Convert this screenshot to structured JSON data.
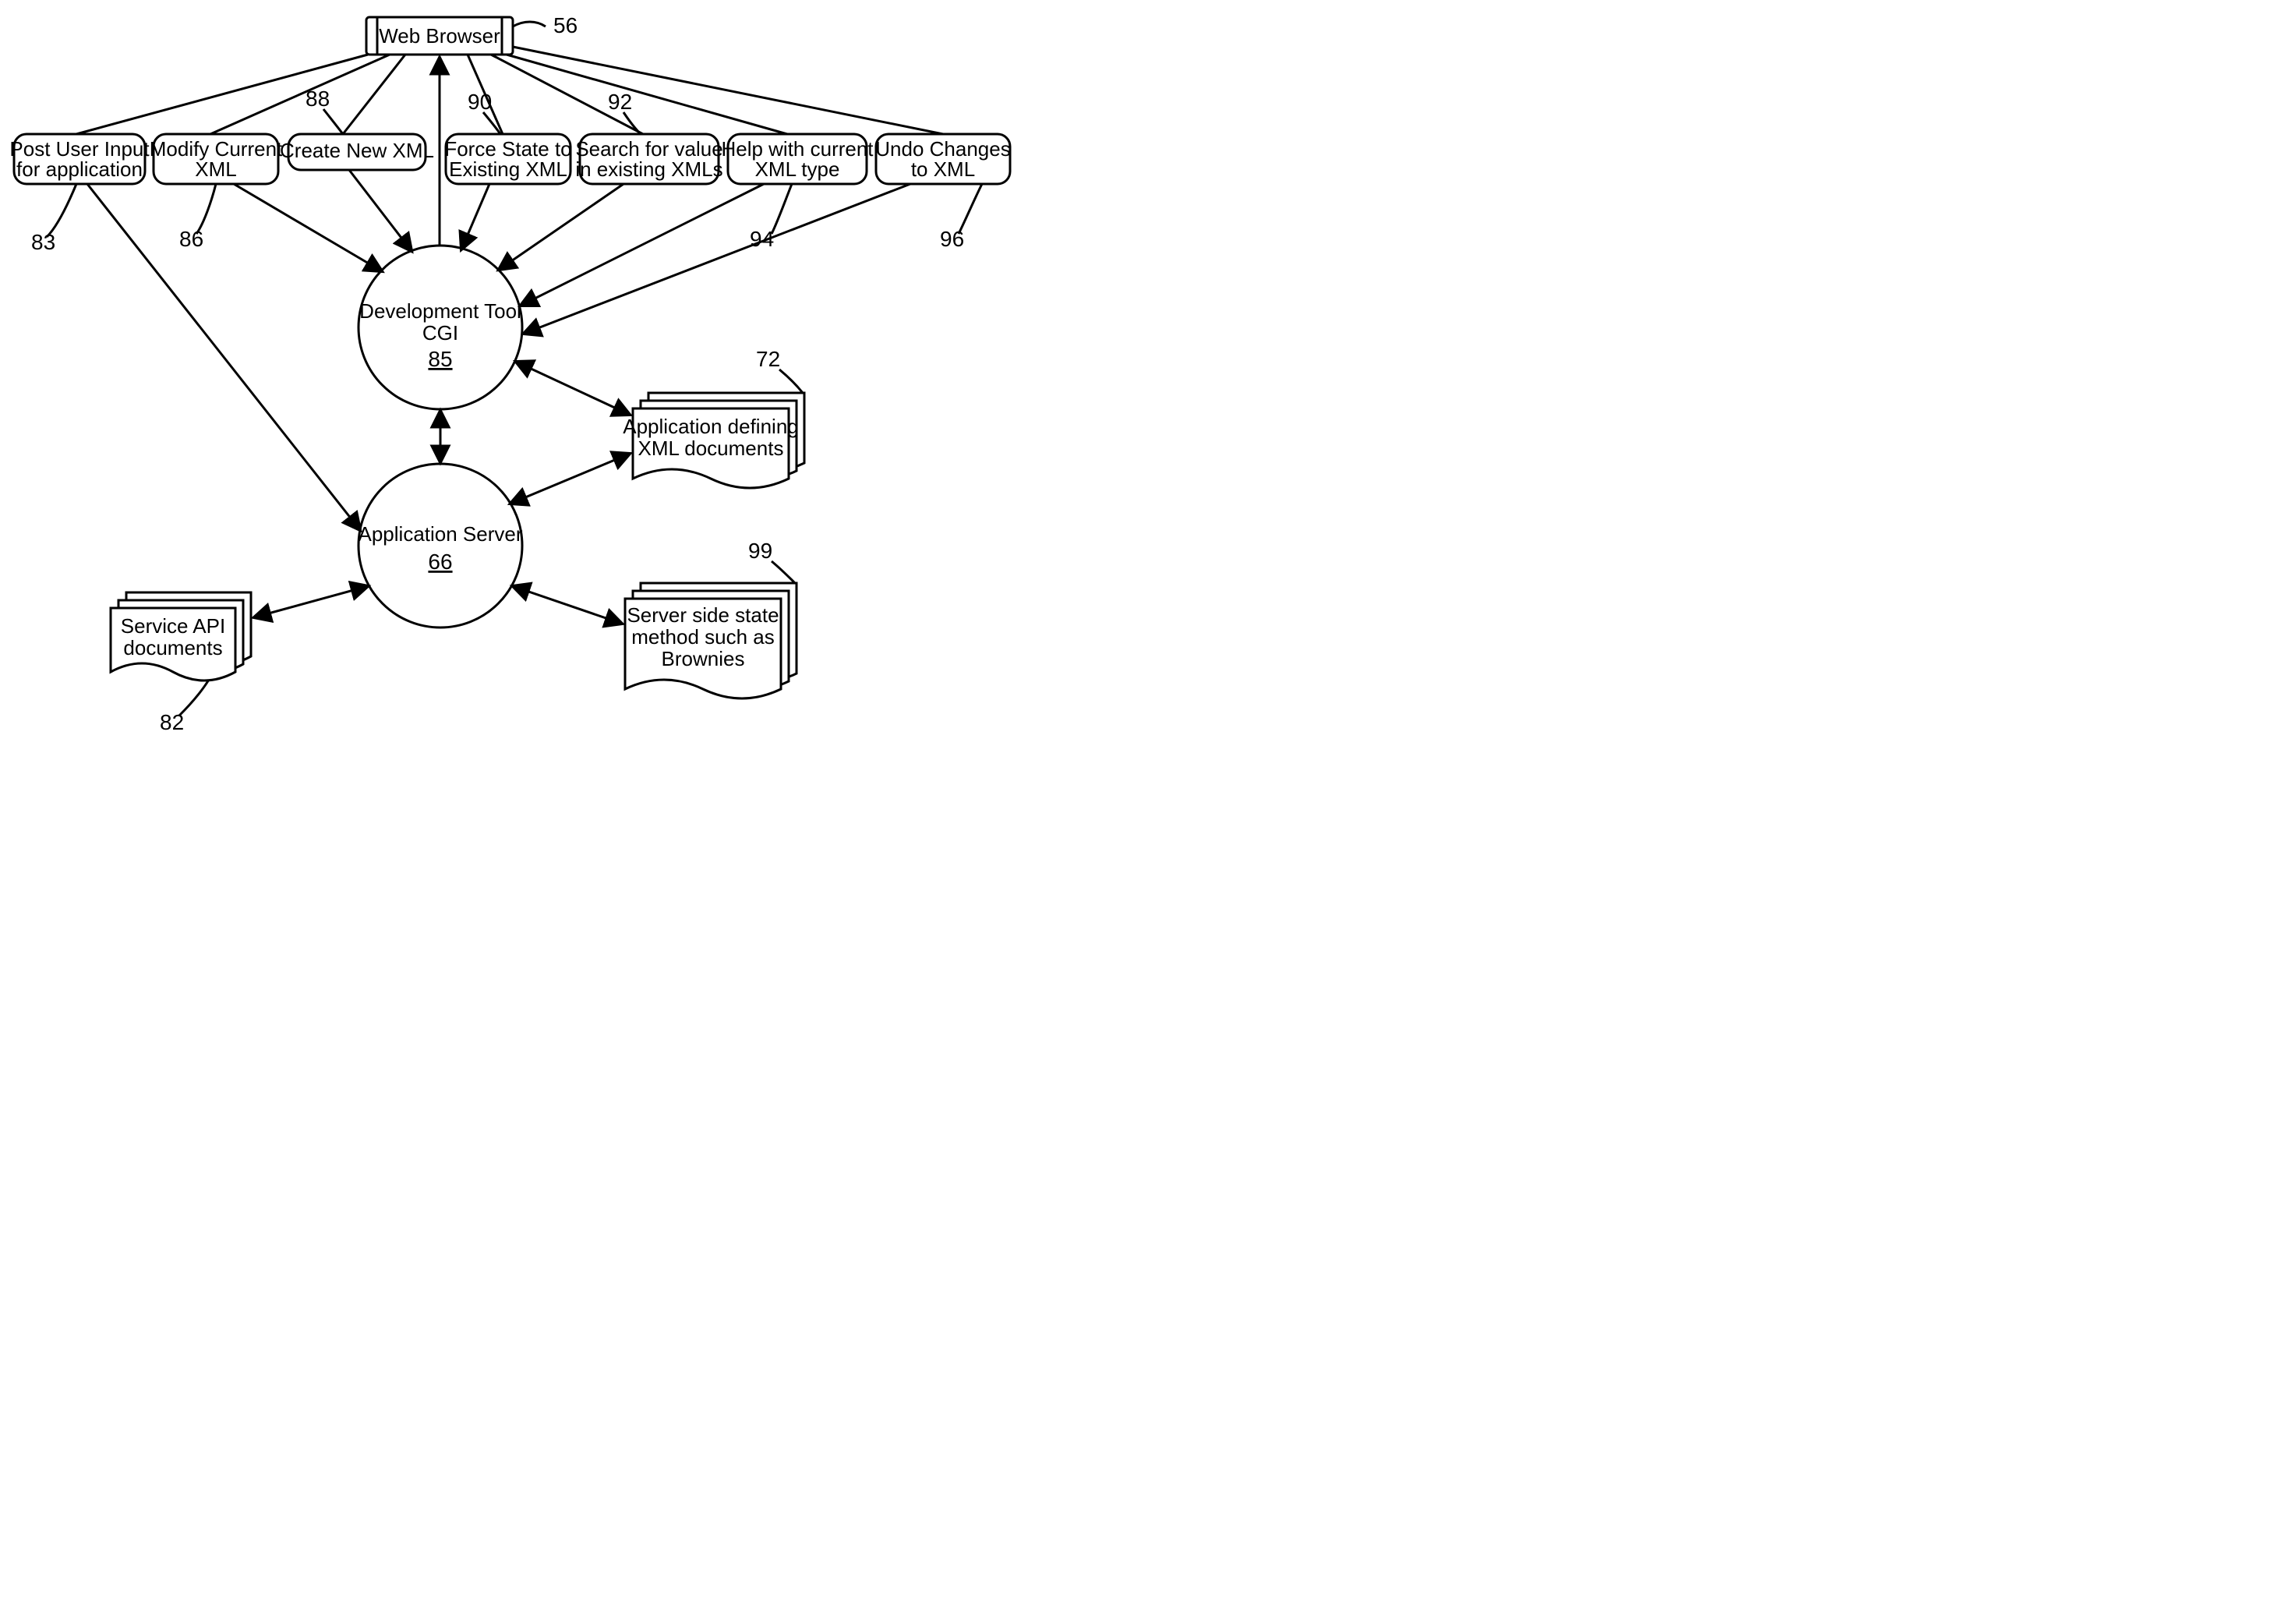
{
  "browser": {
    "label": "Web Browser",
    "ref": "56"
  },
  "actions": {
    "post": {
      "l1": "Post User Input",
      "l2": "for application",
      "ref": "83"
    },
    "modify": {
      "l1": "Modify Current",
      "l2": "XML",
      "ref": "86"
    },
    "create": {
      "l1": "Create New XML",
      "ref": "88"
    },
    "force": {
      "l1": "Force State to",
      "l2": "Existing XML",
      "ref": "90"
    },
    "search": {
      "l1": "Search for value",
      "l2": "in existing XMLs",
      "ref": "92"
    },
    "help": {
      "l1": "Help with current",
      "l2": "XML type",
      "ref": "94"
    },
    "undo": {
      "l1": "Undo Changes",
      "l2": "to XML",
      "ref": "96"
    }
  },
  "cgi": {
    "l1": "Development Tool",
    "l2": "CGI",
    "ref": "85"
  },
  "appserver": {
    "l1": "Application Server",
    "ref": "66"
  },
  "docs": {
    "appxml": {
      "l1": "Application defining",
      "l2": "XML documents",
      "ref": "72"
    },
    "svc": {
      "l1": "Service API",
      "l2": "documents",
      "ref": "82"
    },
    "state": {
      "l1": "Server side state",
      "l2": "method such as",
      "l3": "Brownies",
      "ref": "99"
    }
  }
}
